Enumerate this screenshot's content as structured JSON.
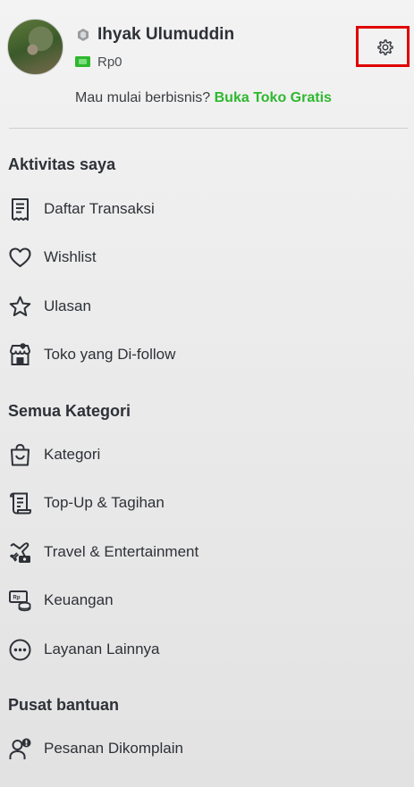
{
  "profile": {
    "name": "Ihyak Ulumuddin",
    "balance": "Rp0"
  },
  "promo": {
    "text": "Mau mulai berbisnis? ",
    "link": "Buka Toko Gratis"
  },
  "sections": {
    "activity": {
      "title": "Aktivitas saya",
      "items": [
        {
          "label": "Daftar Transaksi",
          "icon": "receipt-icon"
        },
        {
          "label": "Wishlist",
          "icon": "heart-icon"
        },
        {
          "label": "Ulasan",
          "icon": "star-icon"
        },
        {
          "label": "Toko yang Di-follow",
          "icon": "store-icon"
        }
      ]
    },
    "categories": {
      "title": "Semua Kategori",
      "items": [
        {
          "label": "Kategori",
          "icon": "shopping-bag-icon"
        },
        {
          "label": "Top-Up & Tagihan",
          "icon": "bill-icon"
        },
        {
          "label": "Travel & Entertainment",
          "icon": "travel-icon"
        },
        {
          "label": "Keuangan",
          "icon": "money-icon"
        },
        {
          "label": "Layanan Lainnya",
          "icon": "more-services-icon"
        }
      ]
    },
    "help": {
      "title": "Pusat bantuan",
      "items": [
        {
          "label": "Pesanan Dikomplain",
          "icon": "complaint-icon"
        }
      ]
    }
  },
  "colors": {
    "accent": "#2eb82e",
    "highlight_box": "#e00000",
    "text": "#2e3137"
  }
}
